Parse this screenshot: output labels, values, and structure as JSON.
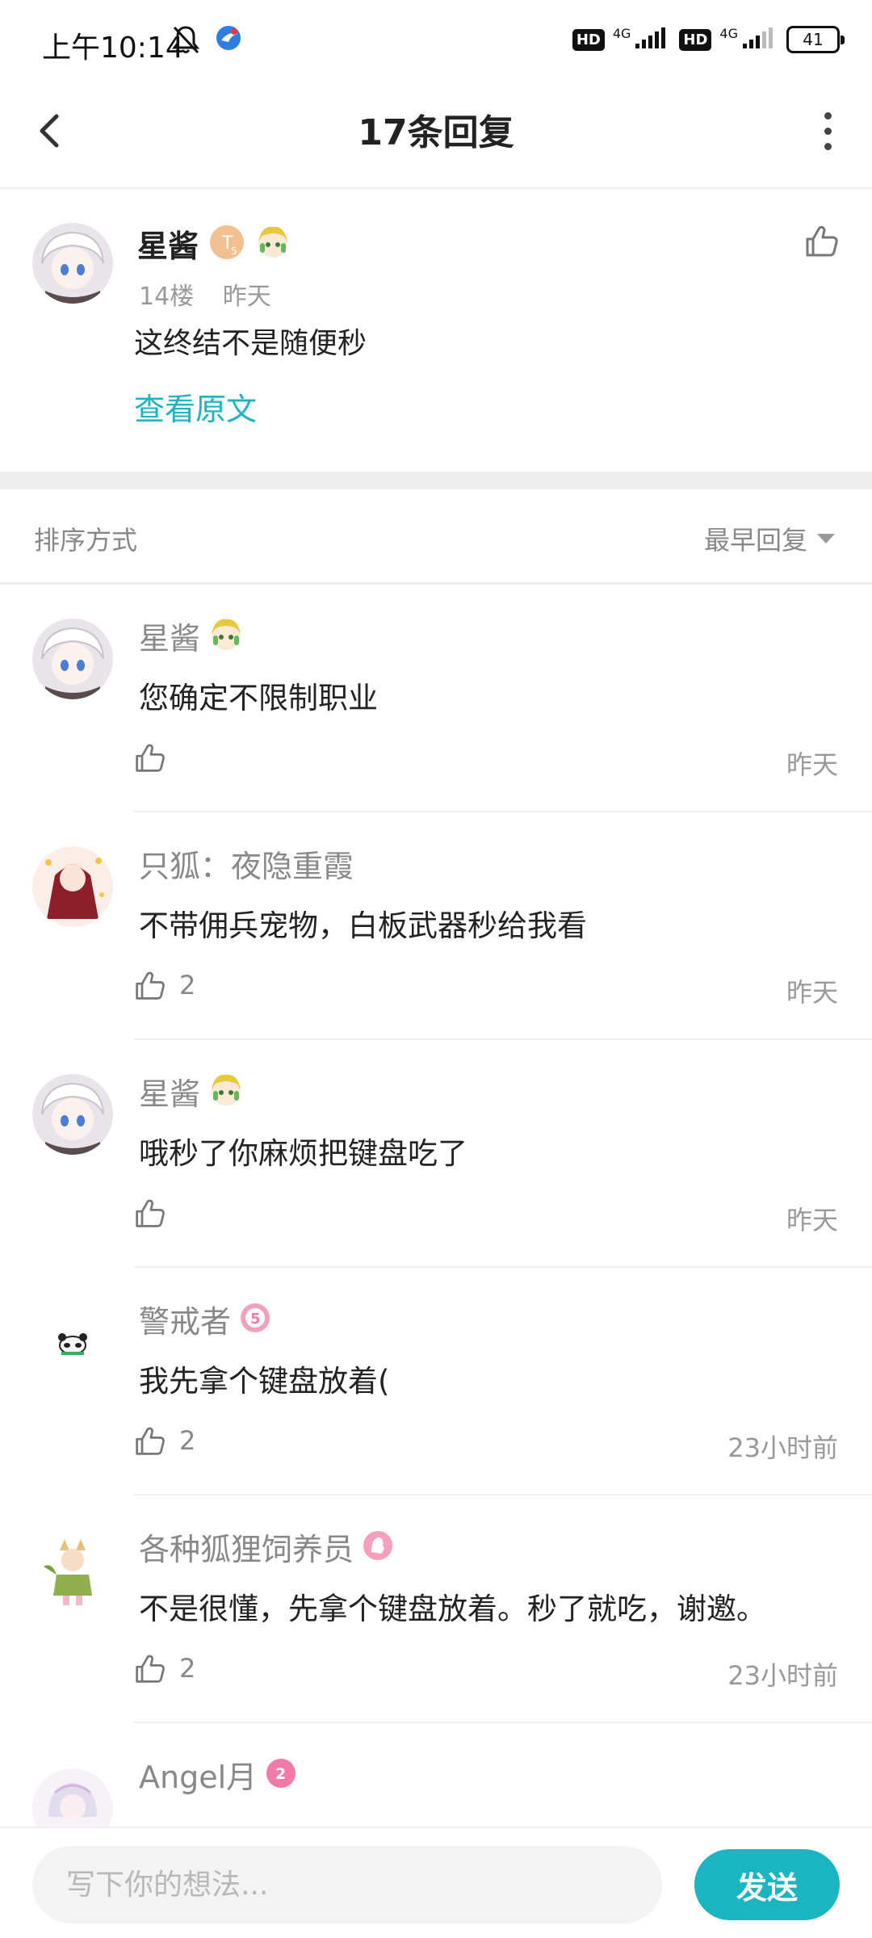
{
  "status_bar": {
    "time": "上午10:14",
    "hd1": "HD",
    "net1": "4G",
    "hd2": "HD",
    "net2": "4G",
    "battery": "41"
  },
  "nav": {
    "title": "17条回复"
  },
  "main_post": {
    "author": "星酱",
    "floor": "14楼",
    "time": "昨天",
    "content": "这终结不是随便秒",
    "view_original": "查看原文"
  },
  "sort": {
    "label": "排序方式",
    "value": "最早回复"
  },
  "replies": [
    {
      "author": "星酱",
      "content": "您确定不限制职业",
      "likes": "",
      "time": "昨天"
    },
    {
      "author": "只狐：夜隐重霞",
      "content": "不带佣兵宠物，白板武器秒给我看",
      "likes": "2",
      "time": "昨天"
    },
    {
      "author": "星酱",
      "content": "哦秒了你麻烦把键盘吃了",
      "likes": "",
      "time": "昨天"
    },
    {
      "author": "警戒者",
      "content": "我先拿个键盘放着(",
      "likes": "2",
      "time": "23小时前"
    },
    {
      "author": "各种狐狸饲养员",
      "content": "不是很懂，先拿个键盘放着。秒了就吃，谢邀。",
      "likes": "2",
      "time": "23小时前"
    },
    {
      "author": "Angel月",
      "content": "",
      "likes": "",
      "time": ""
    }
  ],
  "badges": {
    "level_5_badge": "5",
    "level_2_badge": "2"
  },
  "composer": {
    "placeholder": "写下你的想法...",
    "send_label": "发送"
  },
  "colors": {
    "accent": "#1ab5c0",
    "muted_text": "#888888",
    "divider": "#eeeeee"
  }
}
